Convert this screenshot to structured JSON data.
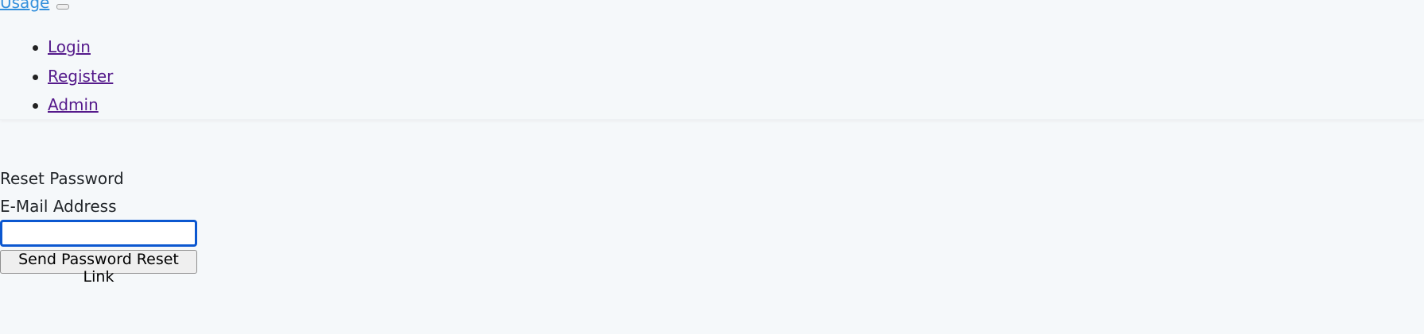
{
  "navbar": {
    "brand": "Usage",
    "links": [
      {
        "label": "Login"
      },
      {
        "label": "Register"
      },
      {
        "label": "Admin"
      }
    ]
  },
  "form": {
    "header": "Reset Password",
    "email_label": "E-Mail Address",
    "email_value": "",
    "submit_label": "Send Password Reset Link"
  },
  "colors": {
    "background": "#f5f8fa",
    "brand_link": "#3490dc",
    "visited_link": "#551a8b",
    "input_focus_border": "#0b57d0"
  }
}
